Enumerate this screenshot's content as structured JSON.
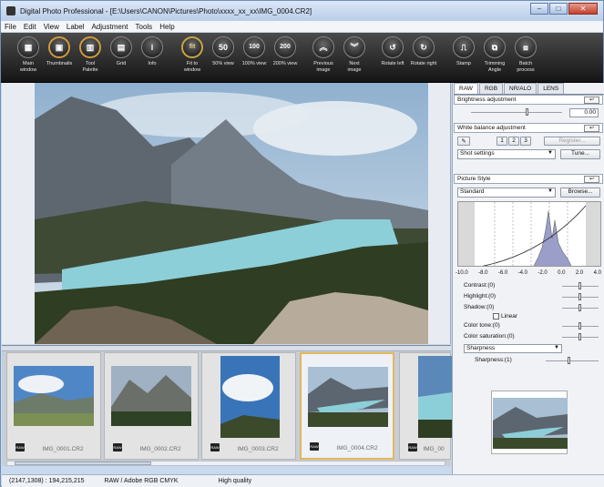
{
  "window": {
    "title": "Digital Photo Professional - [E:\\Users\\CANON\\Pictures\\Photo\\xxxx_xx_xx\\IMG_0004.CR2]"
  },
  "menu": [
    "File",
    "Edit",
    "View",
    "Label",
    "Adjustment",
    "Tools",
    "Help"
  ],
  "toolbar": [
    {
      "label": "Main\nwindow",
      "icon": "grid"
    },
    {
      "label": "Thumbnails",
      "icon": "image"
    },
    {
      "label": "Tool\nPalette",
      "icon": "palette"
    },
    {
      "label": "Grid",
      "icon": "grid"
    },
    {
      "label": "Info",
      "icon": "info"
    },
    {
      "label": "Fit to\nwindow",
      "icon": "fit"
    },
    {
      "label": "50% view",
      "icon": "50"
    },
    {
      "label": "100% view",
      "icon": "100"
    },
    {
      "label": "200% view",
      "icon": "200"
    },
    {
      "label": "Previous\nimage",
      "icon": "up"
    },
    {
      "label": "Next\nimage",
      "icon": "down"
    },
    {
      "label": "Rotate left",
      "icon": "rotl"
    },
    {
      "label": "Rotate right",
      "icon": "rotr"
    },
    {
      "label": "Stamp",
      "icon": "stamp"
    },
    {
      "label": "Trimming\nAngle",
      "icon": "trim"
    },
    {
      "label": "Batch\nprocess",
      "icon": "batch"
    }
  ],
  "thumbs": [
    {
      "name": "IMG_0001.CR2",
      "raw": "RAW"
    },
    {
      "name": "IMG_0002.CR2",
      "raw": "RAW"
    },
    {
      "name": "IMG_0003.CR2",
      "raw": "RAW"
    },
    {
      "name": "IMG_0004.CR2",
      "raw": "RAW"
    },
    {
      "name": "IMG_00",
      "raw": "RAW"
    }
  ],
  "status": {
    "coords": "(2147,1308) : 194,215,215",
    "mode": "RAW / Adobe RGB  CMYK",
    "quality": "High quality"
  },
  "panel": {
    "tabs": [
      "RAW",
      "RGB",
      "NR/ALO",
      "LENS"
    ],
    "brightness": {
      "title": "Brightness adjustment",
      "value": "0.00"
    },
    "whitebalance": {
      "title": "White balance adjustment",
      "n1": "1",
      "n2": "2",
      "n3": "3",
      "register": "Register...",
      "setting": "Shot settings",
      "tune": "Tune..."
    },
    "picstyle": {
      "title": "Picture Style",
      "style": "Standard",
      "browse": "Browse..."
    },
    "axis": [
      "-10.0",
      "-8.0",
      "-6.0",
      "-4.0",
      "-2.0",
      "0.0",
      "2.0",
      "4.0"
    ],
    "contrast": "Contrast:(0)",
    "highlight": "Highlight:(0)",
    "shadow": "Shadow:(0)",
    "linear": "Linear",
    "colortone": "Color tone:(0)",
    "colorsat": "Color saturation:(0)",
    "sharpsel": "Sharpness",
    "sharpness": "Sharpness:(1)"
  }
}
